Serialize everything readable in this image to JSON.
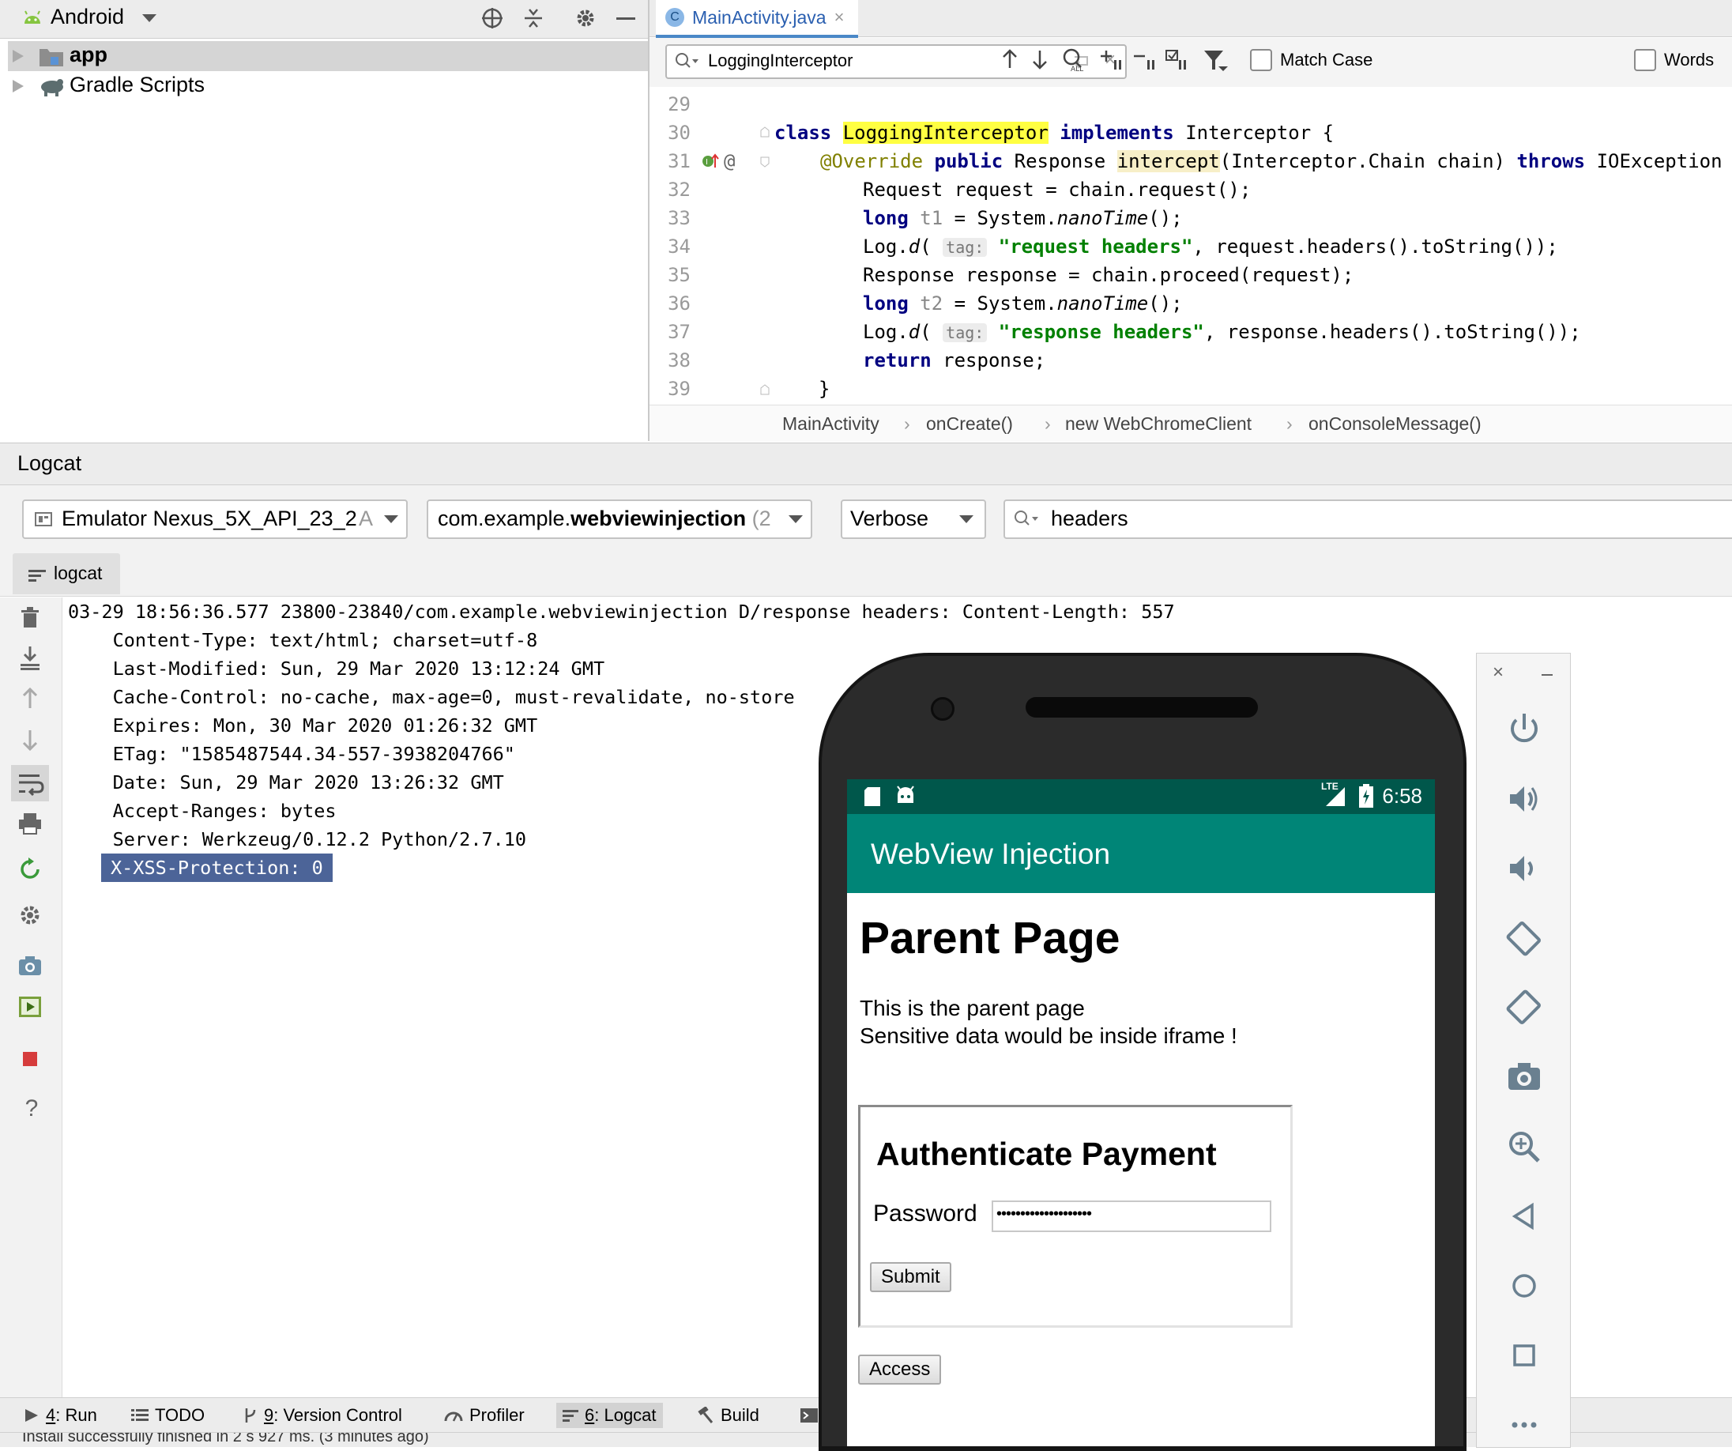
{
  "project": {
    "view_selector": "Android",
    "tree": [
      {
        "label": "app",
        "selected": true
      },
      {
        "label": "Gradle Scripts",
        "selected": false
      }
    ]
  },
  "editor": {
    "tab_label": "MainActivity.java",
    "tab_icon_letter": "C",
    "search": {
      "value": "LoggingInterceptor",
      "match_case_label": "Match Case",
      "words_label": "Words"
    },
    "line_numbers": [
      "29",
      "30",
      "31",
      "32",
      "33",
      "34",
      "35",
      "36",
      "37",
      "38",
      "39"
    ],
    "code": {
      "l30": {
        "kw1": "class",
        "name": "LoggingInterceptor",
        "kw2": "implements",
        "rest": "Interceptor {"
      },
      "l31": {
        "ann": "@Override",
        "kw1": "public",
        "t1": "Response",
        "method": "intercept",
        "t2": "(Interceptor.Chain chain)",
        "kw2": "throws",
        "t3": "IOException {"
      },
      "l32": "Request request = chain.request();",
      "l33": {
        "kw": "long",
        "var": "t1",
        "t1": "= System.",
        "call": "nanoTime",
        "t2": "();"
      },
      "l34": {
        "t1": "Log.",
        "call": "d",
        "t2": "(",
        "hint": "tag:",
        "str": "\"request headers\"",
        "t3": ", request.headers().toString());"
      },
      "l35": "Response response = chain.proceed(request);",
      "l36": {
        "kw": "long",
        "var": "t2",
        "t1": "= System.",
        "call": "nanoTime",
        "t2": "();"
      },
      "l37": {
        "t1": "Log.",
        "call": "d",
        "t2": "(",
        "hint": "tag:",
        "str": "\"response headers\"",
        "t3": ", response.headers().toString());"
      },
      "l38": {
        "kw": "return",
        "rest": "response;"
      },
      "l39": "}"
    },
    "breadcrumbs": [
      "MainActivity",
      "onCreate()",
      "new WebChromeClient",
      "onConsoleMessage()"
    ]
  },
  "logcat": {
    "title": "Logcat",
    "device": "Emulator Nexus_5X_API_23_2",
    "device_suffix": "A",
    "process_prefix": "com.example.",
    "process_bold": "webviewinjection",
    "process_suffix": "(2",
    "level": "Verbose",
    "filter": "headers",
    "subtab": "logcat",
    "lines": [
      "03-29 18:56:36.577 23800-23840/com.example.webviewinjection D/response headers: Content-Length: 557",
      "    Content-Type: text/html; charset=utf-8",
      "    Last-Modified: Sun, 29 Mar 2020 13:12:24 GMT",
      "    Cache-Control: no-cache, max-age=0, must-revalidate, no-store",
      "    Expires: Mon, 30 Mar 2020 01:26:32 GMT",
      "    ETag: \"1585487544.34-557-3938204766\"",
      "    Date: Sun, 29 Mar 2020 13:26:32 GMT",
      "    Accept-Ranges: bytes",
      "    Server: Werkzeug/0.12.2 Python/2.7.10"
    ],
    "selected_line": "X-XSS-Protection: 0"
  },
  "toolwindows": [
    {
      "key": "4",
      "label": ": Run"
    },
    {
      "key": "",
      "label": "TODO"
    },
    {
      "key": "9",
      "label": ": Version Control"
    },
    {
      "key": "",
      "label": "Profiler"
    },
    {
      "key": "6",
      "label": ": Logcat"
    },
    {
      "key": "",
      "label": "Build"
    }
  ],
  "status_text": "Install successfully finished in 2 s 927 ms. (3 minutes ago)",
  "phone": {
    "time": "6:58",
    "network": "LTE",
    "app_title": "WebView Injection",
    "page_heading": "Parent Page",
    "para1": "This is the parent page",
    "para2": "Sensitive data would be inside iframe !",
    "iframe_heading": "Authenticate Payment",
    "password_label": "Password",
    "password_value": "••••••••••••••••••••",
    "submit_label": "Submit",
    "access_label": "Access"
  }
}
